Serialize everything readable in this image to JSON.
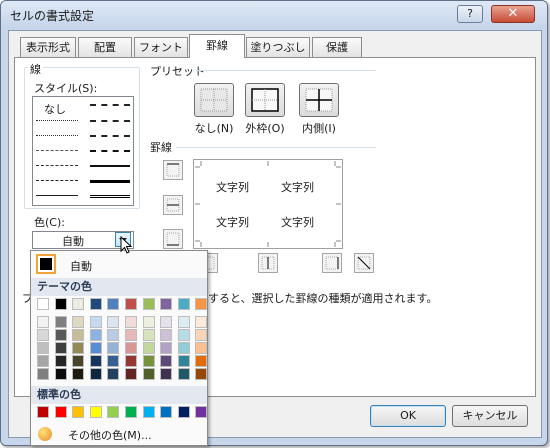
{
  "window": {
    "title": "セルの書式設定",
    "help_glyph": "?",
    "close_glyph": "✕"
  },
  "tabs": [
    "表示形式",
    "配置",
    "フォント",
    "罫線",
    "塗りつぶし",
    "保護"
  ],
  "active_tab": "罫線",
  "line": {
    "group_label": "線",
    "style_label": "スタイル(S):",
    "none_label": "なし",
    "color_label": "色(C):",
    "color_value": "自動"
  },
  "preset": {
    "group_label": "プリセット",
    "none_label": "なし(N)",
    "outline_label": "外枠(O)",
    "inside_label": "内側(I)"
  },
  "border": {
    "group_label": "罫線",
    "preview_texts": [
      "文字列",
      "文字列",
      "文字列",
      "文字列"
    ]
  },
  "hint": {
    "prefix": "ブ",
    "text": "すると、選択した罫線の種類が適用されます。"
  },
  "buttons": {
    "ok": "OK",
    "cancel": "キャンセル"
  },
  "palette": {
    "auto_label": "自動",
    "theme_label": "テーマの色",
    "standard_label": "標準の色",
    "more_label": "その他の色(M)...",
    "theme_top": [
      "#ffffff",
      "#000000",
      "#eeece1",
      "#1f497d",
      "#4f81bd",
      "#c0504d",
      "#9bbb59",
      "#8064a2",
      "#4bacc6",
      "#f79646"
    ],
    "theme_shades": [
      [
        "#f2f2f2",
        "#7f7f7f",
        "#ddd9c3",
        "#c6d9f0",
        "#dbe5f1",
        "#f2dcdb",
        "#ebf1dd",
        "#e5e0ec",
        "#dbeef3",
        "#fdeada"
      ],
      [
        "#d8d8d8",
        "#595959",
        "#c4bd97",
        "#8db3e2",
        "#b8cce4",
        "#e5b9b7",
        "#d7e3bc",
        "#ccc1d9",
        "#b7dde8",
        "#fbd5b5"
      ],
      [
        "#bfbfbf",
        "#3f3f3f",
        "#938953",
        "#548dd4",
        "#95b3d7",
        "#d99694",
        "#c3d69b",
        "#b2a2c7",
        "#92cddc",
        "#fac08f"
      ],
      [
        "#a5a5a5",
        "#262626",
        "#494429",
        "#17365d",
        "#366092",
        "#953734",
        "#76923c",
        "#5f497a",
        "#31859b",
        "#e36c09"
      ],
      [
        "#7f7f7f",
        "#0c0c0c",
        "#1d1b10",
        "#0f243e",
        "#244061",
        "#632423",
        "#4f6128",
        "#3f3151",
        "#205867",
        "#974806"
      ]
    ],
    "standard": [
      "#c00000",
      "#ff0000",
      "#ffc000",
      "#ffff00",
      "#92d050",
      "#00b050",
      "#00b0f0",
      "#0070c0",
      "#002060",
      "#7030a0"
    ]
  }
}
